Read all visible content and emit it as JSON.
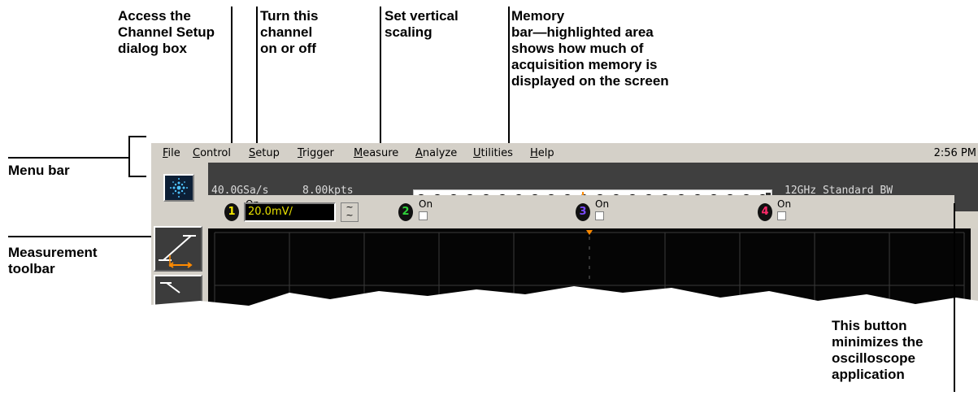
{
  "callouts": {
    "channel_setup": "Access the\nChannel Setup\ndialog box",
    "toggle_channel": "Turn this\nchannel\non or off",
    "vertical_scaling": "Set vertical\nscaling",
    "memory_bar": "Memory\nbar—highlighted area\nshows how much of\nacquisition memory is\ndisplayed on the screen",
    "menu_bar": "Menu bar",
    "measurement_toolbar": "Measurement\ntoolbar",
    "minimize": "This button\nminimizes the\noscilloscope\napplication"
  },
  "menu": {
    "items": [
      {
        "ul": "F",
        "rest": "ile"
      },
      {
        "ul": "C",
        "rest": "ontrol"
      },
      {
        "ul": "S",
        "rest": "etup"
      },
      {
        "ul": "T",
        "rest": "rigger"
      },
      {
        "ul": "M",
        "rest": "easure"
      },
      {
        "ul": "A",
        "rest": "nalyze"
      },
      {
        "ul": "U",
        "rest": "tilities"
      },
      {
        "ul": "H",
        "rest": "elp"
      }
    ],
    "clock": "2:56 PM"
  },
  "status": {
    "sample_rate": "40.0GSa/s",
    "memory_depth": "8.00kpts",
    "bandwidth": "12GHz Standard BW"
  },
  "channels": [
    {
      "number": "1",
      "on_label": "On",
      "checked": true,
      "color": "#f2e600",
      "scale": "20.0mV/"
    },
    {
      "number": "2",
      "on_label": "On",
      "checked": false,
      "color": "#2fd23a"
    },
    {
      "number": "3",
      "on_label": "On",
      "checked": false,
      "color": "#7b4bff"
    },
    {
      "number": "4",
      "on_label": "On",
      "checked": false,
      "color": "#ff2a6a"
    }
  ],
  "icons": {
    "logo": "agilent-logo-icon",
    "measure": "measurement-tool-icon",
    "coupling": "coupling-toggle-icon",
    "minimize": "minimize-icon"
  },
  "colors": {
    "trigger_marker": "#ff8a00",
    "grid": "#3a3a3a",
    "measure_accent": "#ff8a00"
  }
}
